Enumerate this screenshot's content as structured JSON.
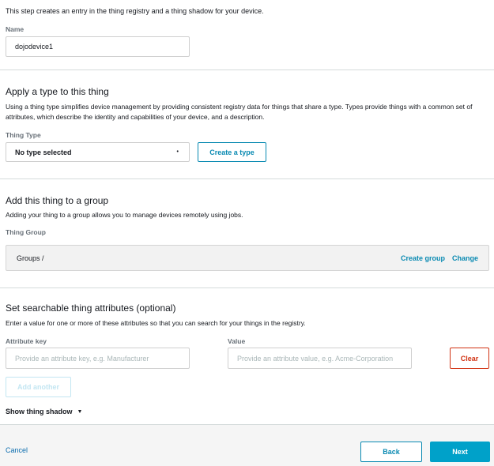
{
  "intro_text": "This step creates an entry in the thing registry and a thing shadow for your device.",
  "name_field": {
    "label": "Name",
    "value": "dojodevice1"
  },
  "type_section": {
    "title": "Apply a type to this thing",
    "description": "Using a thing type simplifies device management by providing consistent registry data for things that share a type. Types provide things with a common set of attributes, which describe the identity and capabilities of your device, and a description.",
    "field_label": "Thing Type",
    "selected_value": "No type selected",
    "caret_icon": "•",
    "create_button": "Create a type"
  },
  "group_section": {
    "title": "Add this thing to a group",
    "description": "Adding your thing to a group allows you to manage devices remotely using jobs.",
    "field_label": "Thing Group",
    "breadcrumb": "Groups /",
    "create_group_link": "Create group",
    "change_link": "Change"
  },
  "attributes_section": {
    "title": "Set searchable thing attributes (optional)",
    "description": "Enter a value for one or more of these attributes so that you can search for your things in the registry.",
    "key_label": "Attribute key",
    "key_placeholder": "Provide an attribute key, e.g. Manufacturer",
    "value_label": "Value",
    "value_placeholder": "Provide an attribute value, e.g. Acme-Corporation",
    "clear_button": "Clear",
    "add_another_button": "Add another",
    "show_shadow_label": "Show thing shadow",
    "show_shadow_caret": "▼"
  },
  "footer": {
    "cancel_label": "Cancel",
    "back_label": "Back",
    "next_label": "Next"
  },
  "colors": {
    "accent": "#00a1c9",
    "link": "#0a8ab2",
    "danger": "#d13212"
  }
}
